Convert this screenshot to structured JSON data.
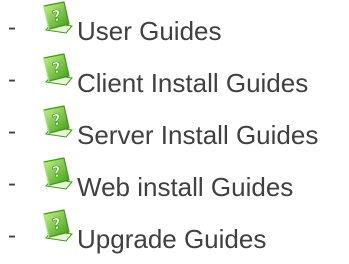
{
  "guides": {
    "bullet": "-",
    "icon": "green-help-book-icon",
    "items": [
      {
        "label": "User Guides"
      },
      {
        "label": "Client Install Guides"
      },
      {
        "label": "Server Install Guides"
      },
      {
        "label": "Web install Guides"
      },
      {
        "label": "Upgrade Guides"
      }
    ]
  },
  "colors": {
    "text": "#404040",
    "icon_green_light": "#c8f58a",
    "icon_green_dark": "#3c9a14",
    "icon_question": "#ffffff"
  }
}
